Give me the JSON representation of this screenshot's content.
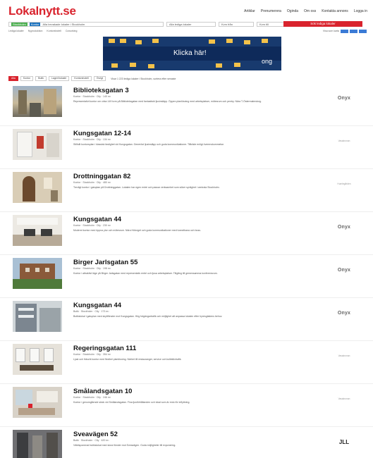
{
  "header": {
    "logo": "Lokalnytt.se",
    "nav": [
      "Artiklar",
      "Prenumerera",
      "Oginda",
      "Om oss",
      "Kontakta annons",
      "Logga in"
    ]
  },
  "search": {
    "tag1": "Stockholm",
    "tag2": "Kontor",
    "value": "Alla bevakade lokaler i Stockholm",
    "sel1": "Alla lediga lokaler",
    "sel2": "Kvm från",
    "sel3": "Kvm till",
    "button": "Sök lediga lokaler"
  },
  "filters": {
    "items": [
      "Lediga lokaler",
      "Nyproduktion",
      "Kontorshotell",
      "Coworking"
    ],
    "right_label": "Visa som karta"
  },
  "banner": {
    "text": "Klicka här!",
    "sub": "ong"
  },
  "tabs": {
    "items": [
      "Alla",
      "Kontor",
      "Butik",
      "Lager/Industri",
      "Kontorshotell",
      "Övrigt"
    ],
    "active": 0,
    "info": "Visar 1 223 lediga lokaler i Stockholm, sortera efter senaste"
  },
  "listings": [
    {
      "title": "Biblioteksgatan 3",
      "meta": "Kontor · Stockholm · City · 149 m²",
      "desc": "Representativt kontor om cirka 149 kvm på Biblioteksgatan med fantastiskt ljusinsläpp. Öppen planlösning med arbetsplatser, mötesrum och pentry. Nära T-Östermalmstorg.",
      "brand": "Onyx"
    },
    {
      "title": "Kungsgatan 12-14",
      "meta": "Kontor · Stockholm · City · 134 m²",
      "desc": "Stilfullt kontorsplan i klassisk fastighet vid Kungsgatan. Generöst ljusinsläpp och goda kommunikationer. Tillträde enligt överenskommelse.",
      "brand": "Vasakronan"
    },
    {
      "title": "Drottninggatan 82",
      "meta": "Kontor · Stockholm · City · 480 m²",
      "desc": "Trevligt kontor i gatuplan på Drottninggatan. Lokalen har egen entré och passar verksamhet som söker synlighet i centrala Stockholm.",
      "brand": "Humlegården"
    },
    {
      "title": "Kungsgatan 44",
      "meta": "Kontor · Stockholm · City · 230 m²",
      "desc": "Modernt kontor med öppna ytor och mötesrum. Nära Hötorget och goda kommunikationer med tunnelbana och buss.",
      "brand": "Onyx"
    },
    {
      "title": "Birger Jarlsgatan 55",
      "meta": "Kontor · Stockholm · City · 198 m²",
      "desc": "Kontor i attraktivt läge på Birger Jarlsgatan med representativ entré och ljusa arbetsplatser. Tillgång till gemensamma konferensrum.",
      "brand": "Onyx"
    },
    {
      "title": "Kungsgatan 44",
      "meta": "Butik · Stockholm · City · 173 m²",
      "desc": "Butikslokal i gatuplan med skyltfönster mot Kungsgatan. Hög fotgängartrafik och möjlighet att anpassa lokalen efter hyresgästens behov.",
      "brand": "Onyx"
    },
    {
      "title": "Regeringsgatan 111",
      "meta": "Kontor · Stockholm · City · 354 m²",
      "desc": "Ljust och fräscht kontor med flexibel planlösning. Närhet till restauranger, service och kollektivtrafik.",
      "brand": "Vasakronan"
    },
    {
      "title": "Smålandsgatan 10",
      "meta": "Kontor · Stockholm · City · 246 m²",
      "desc": "Kontor i genomgående skick vid Smålandsgatan. Fina ljusförhållanden och lokal som är redo för inflyttning.",
      "brand": "Vasakronan"
    },
    {
      "title": "Sveavägen 52",
      "meta": "Butik · Stockholm · City · 420 m²",
      "desc": "Väldisponerad butikslokal med stora fönster mot Sveavägen. Goda möjligheter till exponering.",
      "brand": "JLL"
    }
  ]
}
